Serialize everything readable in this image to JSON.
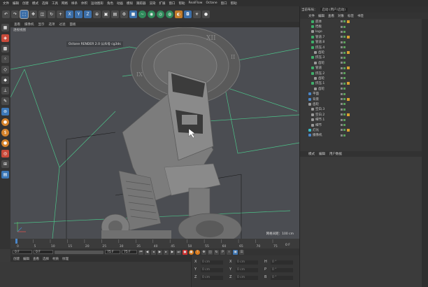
{
  "menubar": {
    "items": [
      "文件",
      "编辑",
      "创建",
      "模式",
      "选择",
      "工具",
      "网格",
      "样条",
      "体积",
      "运动图形",
      "角色",
      "动画",
      "模拟",
      "跟踪器",
      "渲染",
      "扩展",
      "窗口",
      "帮助",
      "RealFlow",
      "Octane",
      "窗口",
      "帮助"
    ],
    "layout_label": "当前布局：",
    "layout_value": "启动 (用户/启动)"
  },
  "toolbar": {
    "undo": "↶",
    "axis_x": "X",
    "axis_y": "Y",
    "axis_z": "Z"
  },
  "viewport": {
    "menu": [
      "查看",
      "摄像机",
      "显示",
      "选项",
      "过滤",
      "面板"
    ],
    "label": "透视视图",
    "title": "Octane RENDER 2.0  公众号 cg3ds",
    "status": "网格间距：100 cm"
  },
  "timeline": {
    "ticks": [
      "0",
      "5",
      "10",
      "15",
      "20",
      "25",
      "30",
      "35",
      "40",
      "45",
      "50",
      "55",
      "60",
      "65",
      "70",
      "75"
    ],
    "end_frame": "0 F"
  },
  "transport": {
    "current": "0 F",
    "start": "0 F",
    "end": "75 F",
    "end2": "75 F"
  },
  "bottombar": {
    "items": [
      "创建",
      "编辑",
      "查看",
      "选择",
      "材质",
      "纹理"
    ]
  },
  "coords": {
    "rows": [
      {
        "a": "X",
        "av": "0 cm",
        "b": "X",
        "bv": "0 cm",
        "c": "H",
        "cv": "0 °"
      },
      {
        "a": "Y",
        "av": "0 cm",
        "b": "Y",
        "bv": "0 cm",
        "c": "P",
        "cv": "0 °"
      },
      {
        "a": "Z",
        "av": "0 cm",
        "b": "Z",
        "bv": "0 cm",
        "c": "B",
        "cv": "0 °"
      }
    ]
  },
  "rightpanel": {
    "menu": [
      "文件",
      "编辑",
      "查看",
      "对象",
      "标签",
      "书签"
    ],
    "objects": [
      {
        "name": "底体",
        "indent": 6,
        "icon": "grn"
      },
      {
        "name": "挡板",
        "indent": 6,
        "icon": "grn"
      },
      {
        "name": "logo",
        "indent": 6,
        "icon": "gry"
      },
      {
        "name": "管道.7",
        "indent": 6,
        "icon": "grn"
      },
      {
        "name": "管道.8",
        "indent": 6,
        "icon": "grn"
      },
      {
        "name": "挤压.4",
        "indent": 6,
        "icon": "grn"
      },
      {
        "name": "齿轮",
        "indent": 10,
        "icon": "gry"
      },
      {
        "name": "挤压.3",
        "indent": 6,
        "icon": "grn"
      },
      {
        "name": "齿轮",
        "indent": 10,
        "icon": "gry"
      },
      {
        "name": "管道",
        "indent": 6,
        "icon": "grn"
      },
      {
        "name": "挤压.2",
        "indent": 6,
        "icon": "grn"
      },
      {
        "name": "齿轮",
        "indent": 10,
        "icon": "gry"
      },
      {
        "name": "挤压.1",
        "indent": 6,
        "icon": "grn"
      },
      {
        "name": "齿轮",
        "indent": 10,
        "icon": "gry"
      },
      {
        "name": "平面",
        "indent": 2,
        "icon": "blu"
      },
      {
        "name": "背景",
        "indent": 2,
        "icon": "blu"
      },
      {
        "name": "齿轮",
        "indent": 2,
        "icon": "gry"
      },
      {
        "name": "空白.3",
        "indent": 6,
        "icon": "gry"
      },
      {
        "name": "空白.2",
        "indent": 6,
        "icon": "gry"
      },
      {
        "name": "细节.1",
        "indent": 6,
        "icon": "gry"
      },
      {
        "name": "细节",
        "indent": 6,
        "icon": "gry"
      },
      {
        "name": "灯光",
        "indent": 2,
        "icon": "cyan"
      },
      {
        "name": "摄像机",
        "indent": 2,
        "icon": "blu"
      }
    ],
    "attr_menu": [
      "模式",
      "编辑",
      "用户数据"
    ]
  },
  "colors": {
    "grid_line": "#4cc48a",
    "viewport_bg": "#4b4d52",
    "accent_blue": "#3b6ea8"
  }
}
